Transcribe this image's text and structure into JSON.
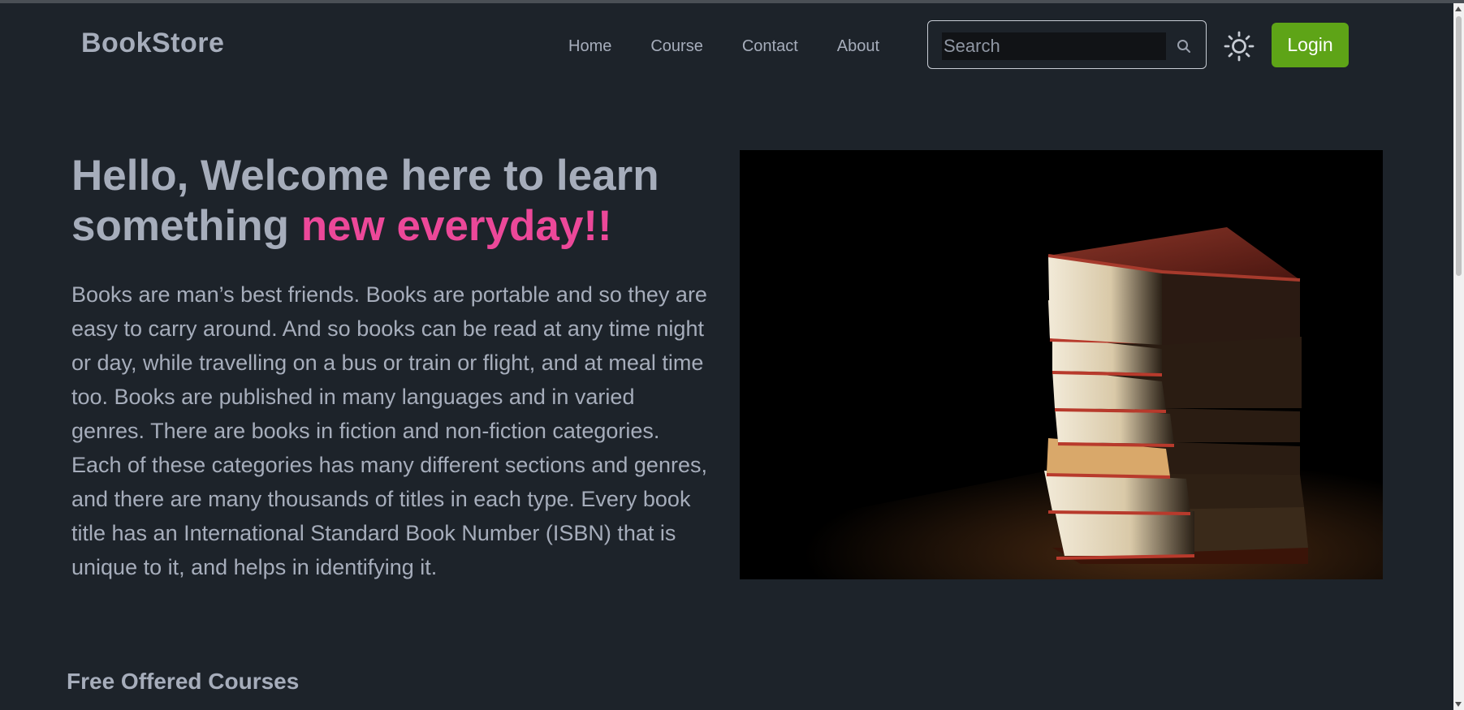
{
  "header": {
    "brand": "BookStore",
    "nav": [
      "Home",
      "Course",
      "Contact",
      "About"
    ],
    "search_placeholder": "Search",
    "login_label": "Login"
  },
  "hero": {
    "title_main": "Hello, Welcome here to learn something ",
    "title_highlight": "new everyday!!",
    "body": "Books are man’s best friends. Books are portable and so they are easy to carry around. And so books can be read at any time night or day, while travelling on a bus or train or flight, and at meal time too. Books are published in many languages and in varied genres. There are books in fiction and non-fiction categories. Each of these categories has many different sections and genres, and there are many thousands of titles in each type. Every book title has an International Standard Book Number (ISBN) that is unique to it, and helps in identifying it."
  },
  "section": {
    "title": "Free Offered Courses"
  },
  "colors": {
    "background": "#1d232a",
    "text": "#a6adbb",
    "highlight": "#ec4899",
    "login_bg": "#5ea417"
  },
  "icons": {
    "search": "search-icon",
    "theme": "sun-icon"
  }
}
